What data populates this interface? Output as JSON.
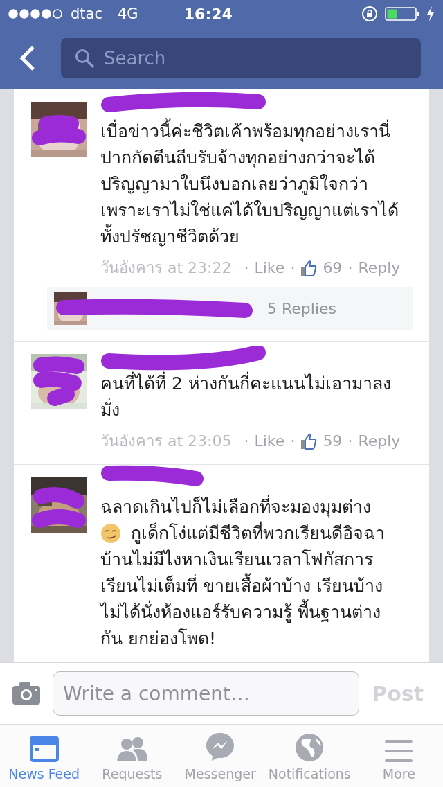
{
  "status_bar": {
    "carrier": "dtac",
    "network": "4G",
    "time": "16:24"
  },
  "nav": {
    "search": {
      "placeholder": "Search"
    }
  },
  "comments": [
    {
      "body": [
        "เบื่อข่าวนี้ค่ะชีวิตเค้าพร้อมทุกอย่างเรานี่ปากกัดตีนถีบรับจ้างทุกอย่างกว่าจะได้ปริญญามาใบนึงบอกเลยว่าภูมิใจกว่าเพราะเราไม่ใช่แค่ได้ใบปริญญาแต่เราได้ทั้งปรัชญาชีวิตด้วย"
      ],
      "meta": [
        {
          "kind": "time",
          "text": "วันอังคาร at 23:22"
        },
        {
          "kind": "sep",
          "text": "·"
        },
        {
          "kind": "link",
          "text": "Like"
        },
        {
          "kind": "sep",
          "text": "·"
        },
        {
          "kind": "likes",
          "text": "69"
        },
        {
          "kind": "sep",
          "text": "·"
        },
        {
          "kind": "link",
          "text": "Reply"
        }
      ],
      "replies": {
        "count": "5 Replies"
      }
    },
    {
      "body": [
        "คนที่ได้ที่ 2 ห่างกันกี่คะแนนไม่เอามาลงมั่ง"
      ],
      "meta": [
        {
          "kind": "time",
          "text": "วันอังคาร at 23:05"
        },
        {
          "kind": "sep",
          "text": "·"
        },
        {
          "kind": "link",
          "text": "Like"
        },
        {
          "kind": "sep",
          "text": "·"
        },
        {
          "kind": "likes",
          "text": "59"
        },
        {
          "kind": "sep",
          "text": "·"
        },
        {
          "kind": "link",
          "text": "Reply"
        }
      ]
    },
    {
      "body": [
        "ฉลาดเกินไปก็ไม่เลือกที่จะมองมุมต่าง",
        {
          "text": "กูเด็กโง่แต่มีชีวิตที่พวกเรียนดีอิจฉา",
          "emoji": true
        },
        "บ้านไม่มีไงหาเงินเรียนเวลาโฟกัสการเรียนไม่เต็มที่ ขายเสื้อผ้าบ้าง เรียนบ้างไม่ได้นั่งห้องแอร์รับความรู้ พื้นฐานต่างกัน ยกย่องโพด!"
      ]
    }
  ],
  "composer": {
    "placeholder": "Write a comment…",
    "post": "Post"
  },
  "tabs": [
    {
      "label": "News Feed",
      "selected": true,
      "kind": "feed"
    },
    {
      "label": "Requests",
      "selected": false,
      "kind": "requests"
    },
    {
      "label": "Messenger",
      "selected": false,
      "kind": "messenger"
    },
    {
      "label": "Notifications",
      "selected": false,
      "kind": "globe"
    },
    {
      "label": "More",
      "selected": false,
      "kind": "more"
    }
  ]
}
